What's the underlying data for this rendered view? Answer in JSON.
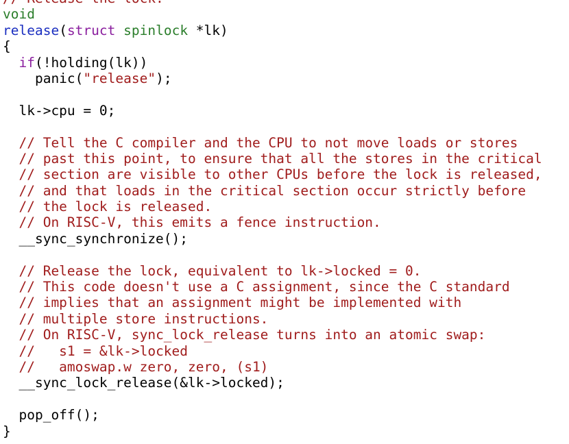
{
  "colors": {
    "background": "#ffffff",
    "comment": "#a01c1c",
    "keyword": "#8a1e9e",
    "type": "#2a7d2a",
    "function": "#1b2fc0",
    "string": "#a01c1c",
    "plain": "#000000"
  },
  "code": {
    "lines": [
      [
        {
          "t": "// Release the lock.",
          "c": "comment"
        }
      ],
      [
        {
          "t": "void",
          "c": "type"
        }
      ],
      [
        {
          "t": "release",
          "c": "func"
        },
        {
          "t": "(",
          "c": "plain"
        },
        {
          "t": "struct",
          "c": "keyword"
        },
        {
          "t": " ",
          "c": "plain"
        },
        {
          "t": "spinlock",
          "c": "type"
        },
        {
          "t": " *lk)",
          "c": "plain"
        }
      ],
      [
        {
          "t": "{",
          "c": "plain"
        }
      ],
      [
        {
          "t": "  ",
          "c": "plain"
        },
        {
          "t": "if",
          "c": "keyword"
        },
        {
          "t": "(!holding(lk))",
          "c": "plain"
        }
      ],
      [
        {
          "t": "    panic(",
          "c": "plain"
        },
        {
          "t": "\"release\"",
          "c": "string"
        },
        {
          "t": ");",
          "c": "plain"
        }
      ],
      [
        {
          "t": "",
          "c": "plain"
        }
      ],
      [
        {
          "t": "  lk->cpu = 0;",
          "c": "plain"
        }
      ],
      [
        {
          "t": "",
          "c": "plain"
        }
      ],
      [
        {
          "t": "  ",
          "c": "plain"
        },
        {
          "t": "// Tell the C compiler and the CPU to not move loads or stores",
          "c": "comment"
        }
      ],
      [
        {
          "t": "  ",
          "c": "plain"
        },
        {
          "t": "// past this point, to ensure that all the stores in the critical",
          "c": "comment"
        }
      ],
      [
        {
          "t": "  ",
          "c": "plain"
        },
        {
          "t": "// section are visible to other CPUs before the lock is released,",
          "c": "comment"
        }
      ],
      [
        {
          "t": "  ",
          "c": "plain"
        },
        {
          "t": "// and that loads in the critical section occur strictly before",
          "c": "comment"
        }
      ],
      [
        {
          "t": "  ",
          "c": "plain"
        },
        {
          "t": "// the lock is released.",
          "c": "comment"
        }
      ],
      [
        {
          "t": "  ",
          "c": "plain"
        },
        {
          "t": "// On RISC-V, this emits a fence instruction.",
          "c": "comment"
        }
      ],
      [
        {
          "t": "  __sync_synchronize();",
          "c": "plain"
        }
      ],
      [
        {
          "t": "",
          "c": "plain"
        }
      ],
      [
        {
          "t": "  ",
          "c": "plain"
        },
        {
          "t": "// Release the lock, equivalent to lk->locked = 0.",
          "c": "comment"
        }
      ],
      [
        {
          "t": "  ",
          "c": "plain"
        },
        {
          "t": "// This code doesn't use a C assignment, since the C standard",
          "c": "comment"
        }
      ],
      [
        {
          "t": "  ",
          "c": "plain"
        },
        {
          "t": "// implies that an assignment might be implemented with",
          "c": "comment"
        }
      ],
      [
        {
          "t": "  ",
          "c": "plain"
        },
        {
          "t": "// multiple store instructions.",
          "c": "comment"
        }
      ],
      [
        {
          "t": "  ",
          "c": "plain"
        },
        {
          "t": "// On RISC-V, sync_lock_release turns into an atomic swap:",
          "c": "comment"
        }
      ],
      [
        {
          "t": "  ",
          "c": "plain"
        },
        {
          "t": "//   s1 = &lk->locked",
          "c": "comment"
        }
      ],
      [
        {
          "t": "  ",
          "c": "plain"
        },
        {
          "t": "//   amoswap.w zero, zero, (s1)",
          "c": "comment"
        }
      ],
      [
        {
          "t": "  __sync_lock_release(&lk->locked);",
          "c": "plain"
        }
      ],
      [
        {
          "t": "",
          "c": "plain"
        }
      ],
      [
        {
          "t": "  pop_off();",
          "c": "plain"
        }
      ],
      [
        {
          "t": "}",
          "c": "plain"
        }
      ]
    ]
  }
}
